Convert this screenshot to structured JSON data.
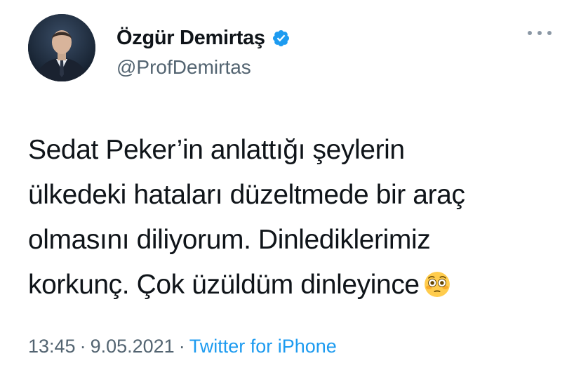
{
  "author": {
    "display_name": "Özgür Demirtaş",
    "handle": "@ProfDemirtas",
    "verified": true,
    "avatar_icon": "profile-photo"
  },
  "more_menu_icon": "ellipsis-icon",
  "tweet": {
    "lines": [
      "Sedat Peker’in anlattığı şeylerin",
      "ülkedeki hataları düzeltmede bir araç",
      "olmasını diliyorum. Dinlediklerimiz",
      "korkunç. Çok üzüldüm dinleyince"
    ],
    "emoji": "flushed-face-emoji"
  },
  "meta": {
    "time": "13:45",
    "separator": "·",
    "date": "9.05.2021",
    "source": "Twitter for iPhone"
  },
  "colors": {
    "verified_blue": "#1d9bf0",
    "link_blue": "#1d9bf0",
    "secondary_text": "#536471",
    "primary_text": "#0f1419"
  }
}
